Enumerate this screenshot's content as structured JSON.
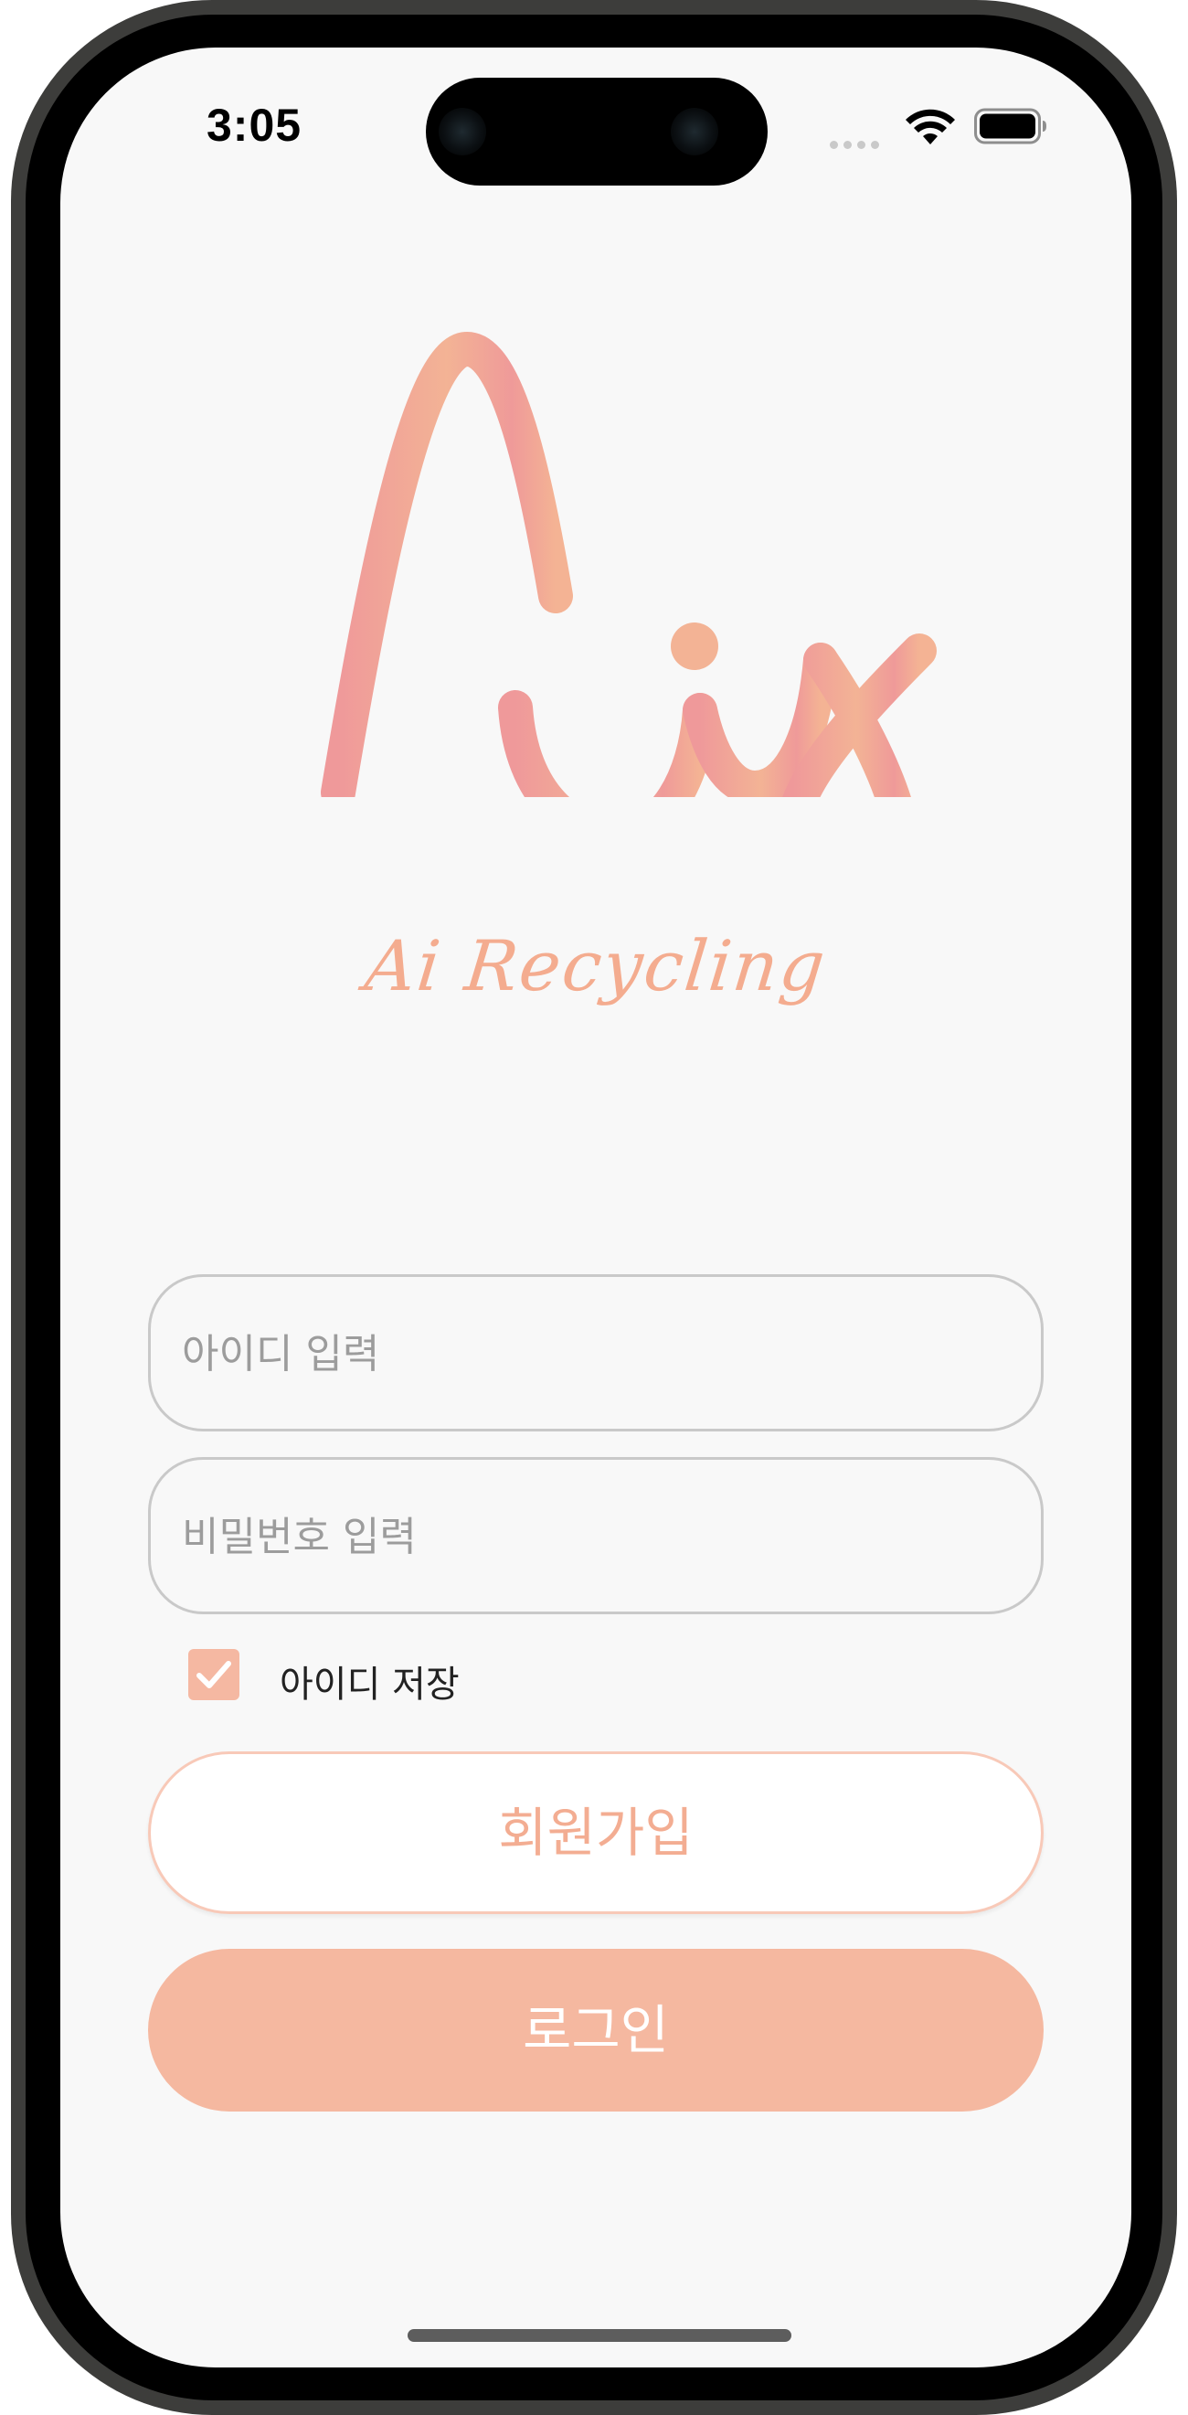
{
  "status_bar": {
    "time": "3:05"
  },
  "brand": {
    "tagline": "Ai Recycling",
    "accent_color": "#f5b8a0",
    "gradient_start": "#ef999a",
    "gradient_end": "#f4b394"
  },
  "login_form": {
    "id_placeholder": "아이디 입력",
    "password_placeholder": "비밀번호 입력",
    "save_id_label": "아이디 저장",
    "save_id_checked": true,
    "signup_label": "회원가입",
    "login_label": "로그인"
  }
}
